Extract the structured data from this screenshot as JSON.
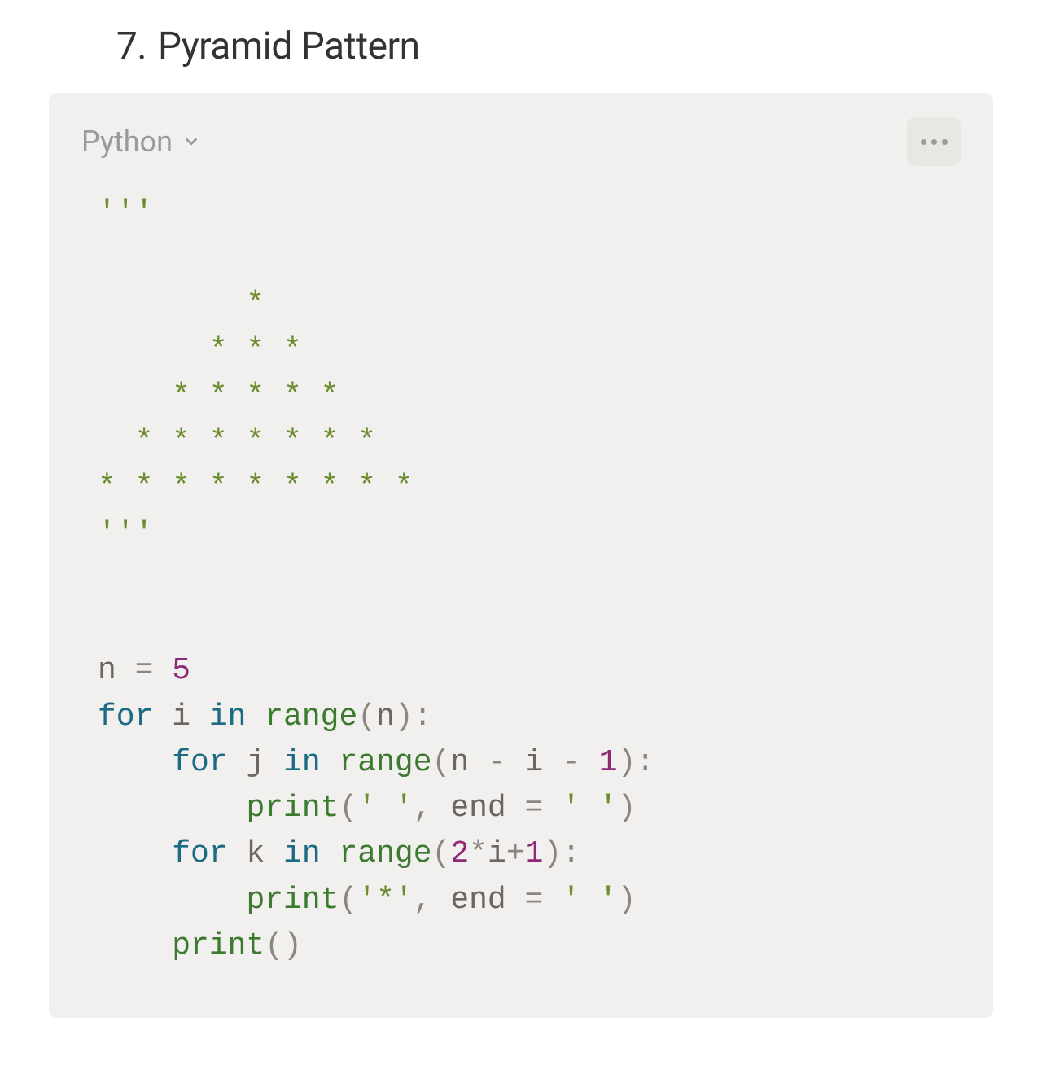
{
  "heading": {
    "number": "7.",
    "title": "Pyramid Pattern"
  },
  "code_card": {
    "language": "Python",
    "icons": {
      "chevron": "chevron-down-icon",
      "more": "more-icon"
    }
  },
  "code": {
    "doc_open": "'''",
    "pyr1": "        *",
    "pyr2": "      * * *",
    "pyr3": "    * * * * *",
    "pyr4": "  * * * * * * *",
    "pyr5": "* * * * * * * * *",
    "doc_close": "'''",
    "l_n": "n",
    "l_eq": " = ",
    "l_5": "5",
    "l_for1": "for",
    "l_i": " i ",
    "l_in1": "in",
    "l_sp": " ",
    "l_range1": "range",
    "l_lp1": "(",
    "l_nn": "n",
    "l_rp1": ")",
    "l_col1": ":",
    "l_ind1": "    ",
    "l_for2": "for",
    "l_j": " j ",
    "l_in2": "in",
    "l_range2": "range",
    "l_lp2": "(",
    "l_nminus": "n ",
    "l_m1": "-",
    "l_iminus": " i ",
    "l_m2": "-",
    "l_one1": " 1",
    "l_rp2": ")",
    "l_col2": ":",
    "l_ind2": "        ",
    "l_print1": "print",
    "l_pargs1a": "(",
    "l_s_space1": "' '",
    "l_comma1": ", ",
    "l_end1": "end ",
    "l_eq_end1": "= ",
    "l_s_space2": "' '",
    "l_pargs1b": ")",
    "l_for3": "for",
    "l_k": " k ",
    "l_in3": "in",
    "l_range3": "range",
    "l_lp3": "(",
    "l_2": "2",
    "l_star": "*",
    "l_ii": "i",
    "l_plus": "+",
    "l_1b": "1",
    "l_rp3": ")",
    "l_col3": ":",
    "l_print2": "print",
    "l_pargs2a": "(",
    "l_s_star": "'*'",
    "l_comma2": ", ",
    "l_end2": "end ",
    "l_eq_end2": "= ",
    "l_s_space3": "' '",
    "l_pargs2b": ")",
    "l_print3": "print",
    "l_pargs3": "()"
  }
}
